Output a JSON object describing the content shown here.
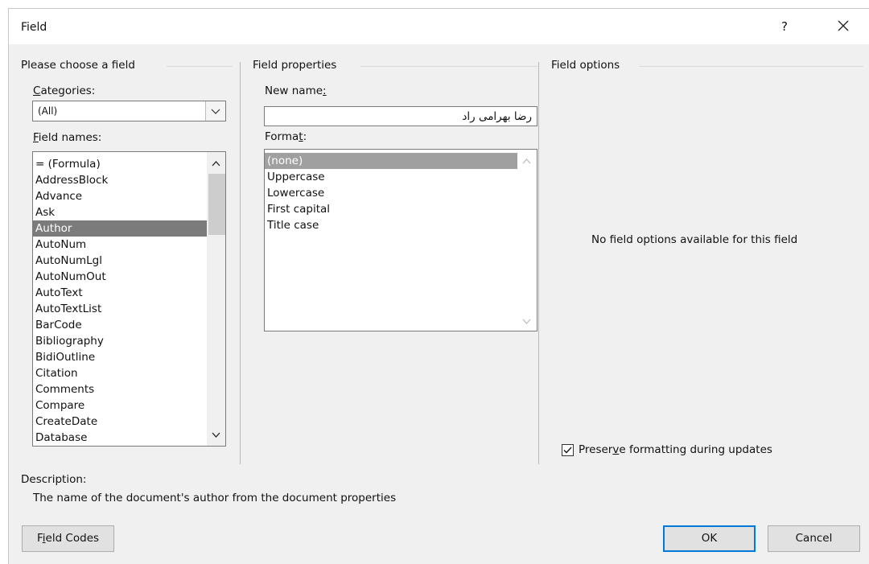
{
  "window": {
    "title": "Field",
    "help_label": "?",
    "close_label": "✕"
  },
  "left_group": {
    "title": "Please choose a field",
    "categories_label_pre": "",
    "categories_label_u": "C",
    "categories_label_post": "ategories:",
    "category_value": "(All)",
    "field_names_label_u": "F",
    "field_names_label_post": "ield names:",
    "field_names": [
      "= (Formula)",
      "AddressBlock",
      "Advance",
      "Ask",
      "Author",
      "AutoNum",
      "AutoNumLgl",
      "AutoNumOut",
      "AutoText",
      "AutoTextList",
      "BarCode",
      "Bibliography",
      "BidiOutline",
      "Citation",
      "Comments",
      "Compare",
      "CreateDate",
      "Database"
    ],
    "selected_field": "Author"
  },
  "mid_group": {
    "title": "Field properties",
    "new_name_label_pre": "New name",
    "new_name_label_u": ":",
    "new_name_value": "رضا بهرامی راد",
    "format_label_pre": "Forma",
    "format_label_u": "t",
    "format_label_post": ":",
    "formats": [
      "(none)",
      "Uppercase",
      "Lowercase",
      "First capital",
      "Title case"
    ],
    "selected_format": "(none)"
  },
  "right_group": {
    "title": "Field options",
    "no_options_text": "No field options available for this field",
    "preserve_label_pre": "Preser",
    "preserve_label_u": "v",
    "preserve_label_post": "e formatting during updates",
    "preserve_checked": true
  },
  "description": {
    "label": "Description:",
    "text": "The name of the document's author from the document properties"
  },
  "buttons": {
    "field_codes_pre": "F",
    "field_codes_u": "i",
    "field_codes_post": "eld Codes",
    "ok": "OK",
    "cancel": "Cancel"
  },
  "colors": {
    "dialog_bg": "#f0f0f0",
    "selection_bg": "#7b7b7b",
    "format_selection_bg": "#a0a0a0"
  }
}
